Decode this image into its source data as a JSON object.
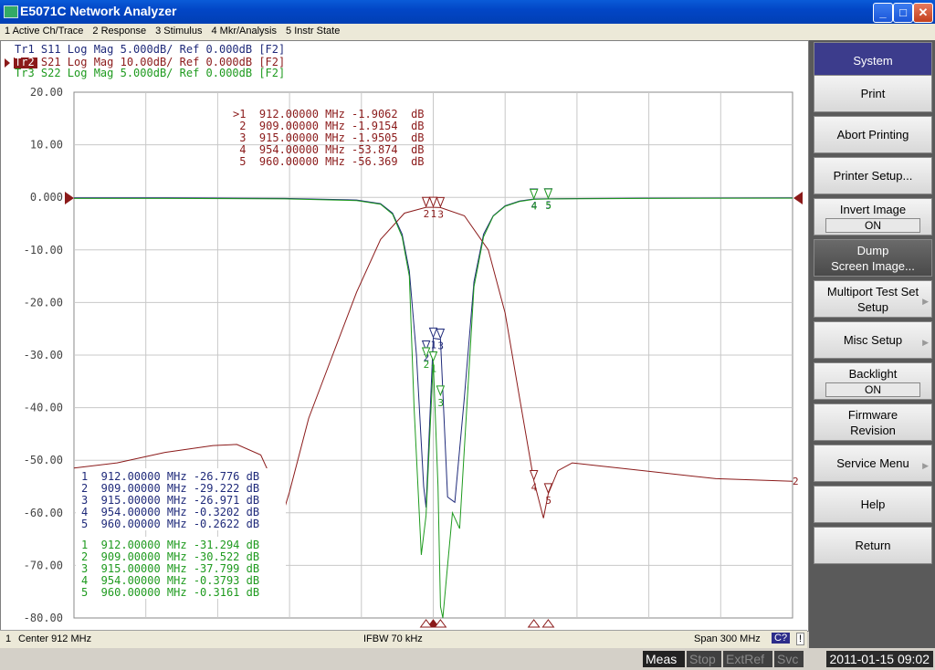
{
  "window": {
    "title": "E5071C Network Analyzer",
    "minimize": "_",
    "maximize": "□",
    "close": "✕"
  },
  "menu": [
    "1 Active Ch/Trace",
    "2 Response",
    "3 Stimulus",
    "4 Mkr/Analysis",
    "5 Instr State"
  ],
  "traces": [
    {
      "id": "Tr1",
      "text": " S11 Log Mag 5.000dB/ Ref 0.000dB [F2]",
      "color": "#1f2a7a"
    },
    {
      "id": "Tr2",
      "text": " S21 Log Mag 10.00dB/ Ref 0.000dB [F2]",
      "color": "#8b1a1a"
    },
    {
      "id": "Tr3",
      "text": " S22 Log Mag 5.000dB/ Ref 0.000dB [F2]",
      "color": "#1e9a1e"
    }
  ],
  "y_ticks": [
    "20.00",
    "10.00",
    "0.000",
    "-10.00",
    "-20.00",
    "-30.00",
    "-40.00",
    "-50.00",
    "-60.00",
    "-70.00",
    "-80.00"
  ],
  "marker_tables": {
    "tr2": [
      ">1  912.00000 MHz -1.9062  dB",
      " 2  909.00000 MHz -1.9154  dB",
      " 3  915.00000 MHz -1.9505  dB",
      " 4  954.00000 MHz -53.874  dB",
      " 5  960.00000 MHz -56.369  dB"
    ],
    "tr1": [
      "1  912.00000 MHz -26.776 dB",
      "2  909.00000 MHz -29.222 dB",
      "3  915.00000 MHz -26.971 dB",
      "4  954.00000 MHz -0.3202 dB",
      "5  960.00000 MHz -0.2622 dB"
    ],
    "tr3": [
      "1  912.00000 MHz -31.294 dB",
      "2  909.00000 MHz -30.522 dB",
      "3  915.00000 MHz -37.799 dB",
      "4  954.00000 MHz -0.3793 dB",
      "5  960.00000 MHz -0.3161 dB"
    ]
  },
  "marker_labels": [
    "1",
    "2",
    "3",
    "4",
    "5"
  ],
  "trace_end_label": "2",
  "status": {
    "channel": "1",
    "center": "Center 912 MHz",
    "ifbw": "IFBW 70 kHz",
    "span": "Span 300 MHz",
    "cal": "C?",
    "warn": "!"
  },
  "softkeys": {
    "header": "System",
    "print": "Print",
    "abort": "Abort Printing",
    "printer_setup": "Printer Setup...",
    "invert_image": "Invert Image",
    "invert_value": "ON",
    "dump_line1": "Dump",
    "dump_line2": "Screen Image...",
    "multiport_line1": "Multiport Test Set",
    "multiport_line2": "Setup",
    "misc": "Misc Setup",
    "backlight": "Backlight",
    "backlight_value": "ON",
    "firmware_line1": "Firmware",
    "firmware_line2": "Revision",
    "service": "Service Menu",
    "help": "Help",
    "return": "Return"
  },
  "indicators": {
    "meas": "Meas",
    "stop": "Stop",
    "extref": "ExtRef",
    "svc": "Svc",
    "datetime": "2011-01-15 09:02"
  },
  "chart_data": {
    "type": "line",
    "xlabel": "",
    "ylabel": "",
    "x_unit": "MHz",
    "xlim": [
      762,
      1062
    ],
    "ylim": [
      -80,
      20
    ],
    "grid": true,
    "series": [
      {
        "name": "Tr1",
        "color": "#1f2a7a",
        "x": [
          762,
          800,
          850,
          880,
          890,
          895,
          899,
          902,
          905,
          908,
          909,
          912,
          915,
          918,
          921,
          925,
          929,
          933,
          937,
          942,
          948,
          954,
          960,
          1000,
          1062
        ],
        "y": [
          -0.1,
          -0.1,
          -0.2,
          -0.5,
          -1.2,
          -3,
          -7,
          -14,
          -30,
          -55,
          -59,
          -26.8,
          -27.0,
          -57,
          -58,
          -38,
          -16,
          -7,
          -3.5,
          -1.6,
          -0.7,
          -0.32,
          -0.26,
          -0.15,
          -0.1
        ]
      },
      {
        "name": "Tr2",
        "color": "#8b1a1a",
        "x": [
          762,
          780,
          800,
          820,
          830,
          840,
          845,
          848,
          852,
          860,
          870,
          880,
          890,
          900,
          909,
          912,
          915,
          925,
          935,
          942,
          948,
          954,
          958,
          960,
          964,
          970,
          980,
          1000,
          1030,
          1062
        ],
        "y": [
          -51.5,
          -50.5,
          -48.5,
          -47.2,
          -47,
          -49,
          -54,
          -62,
          -56,
          -42,
          -30,
          -18,
          -8,
          -3,
          -1.9,
          -1.9,
          -1.95,
          -3.5,
          -10,
          -22,
          -38,
          -53.9,
          -61,
          -56.4,
          -52,
          -50.5,
          -51,
          -52,
          -53.5,
          -54
        ]
      },
      {
        "name": "Tr3",
        "color": "#1e9a1e",
        "x": [
          762,
          800,
          850,
          880,
          890,
          895,
          899,
          902,
          904,
          907,
          909,
          912,
          914,
          915,
          916,
          918,
          920,
          923,
          926,
          929,
          933,
          937,
          942,
          948,
          954,
          960,
          1000,
          1062
        ],
        "y": [
          -0.2,
          -0.2,
          -0.3,
          -0.6,
          -1.3,
          -3.2,
          -7.5,
          -15,
          -40,
          -68,
          -60.5,
          -31.3,
          -55,
          -77.8,
          -80,
          -70,
          -60,
          -63,
          -40,
          -17,
          -7.5,
          -3.6,
          -1.7,
          -0.8,
          -0.38,
          -0.32,
          -0.2,
          -0.15
        ]
      }
    ]
  }
}
